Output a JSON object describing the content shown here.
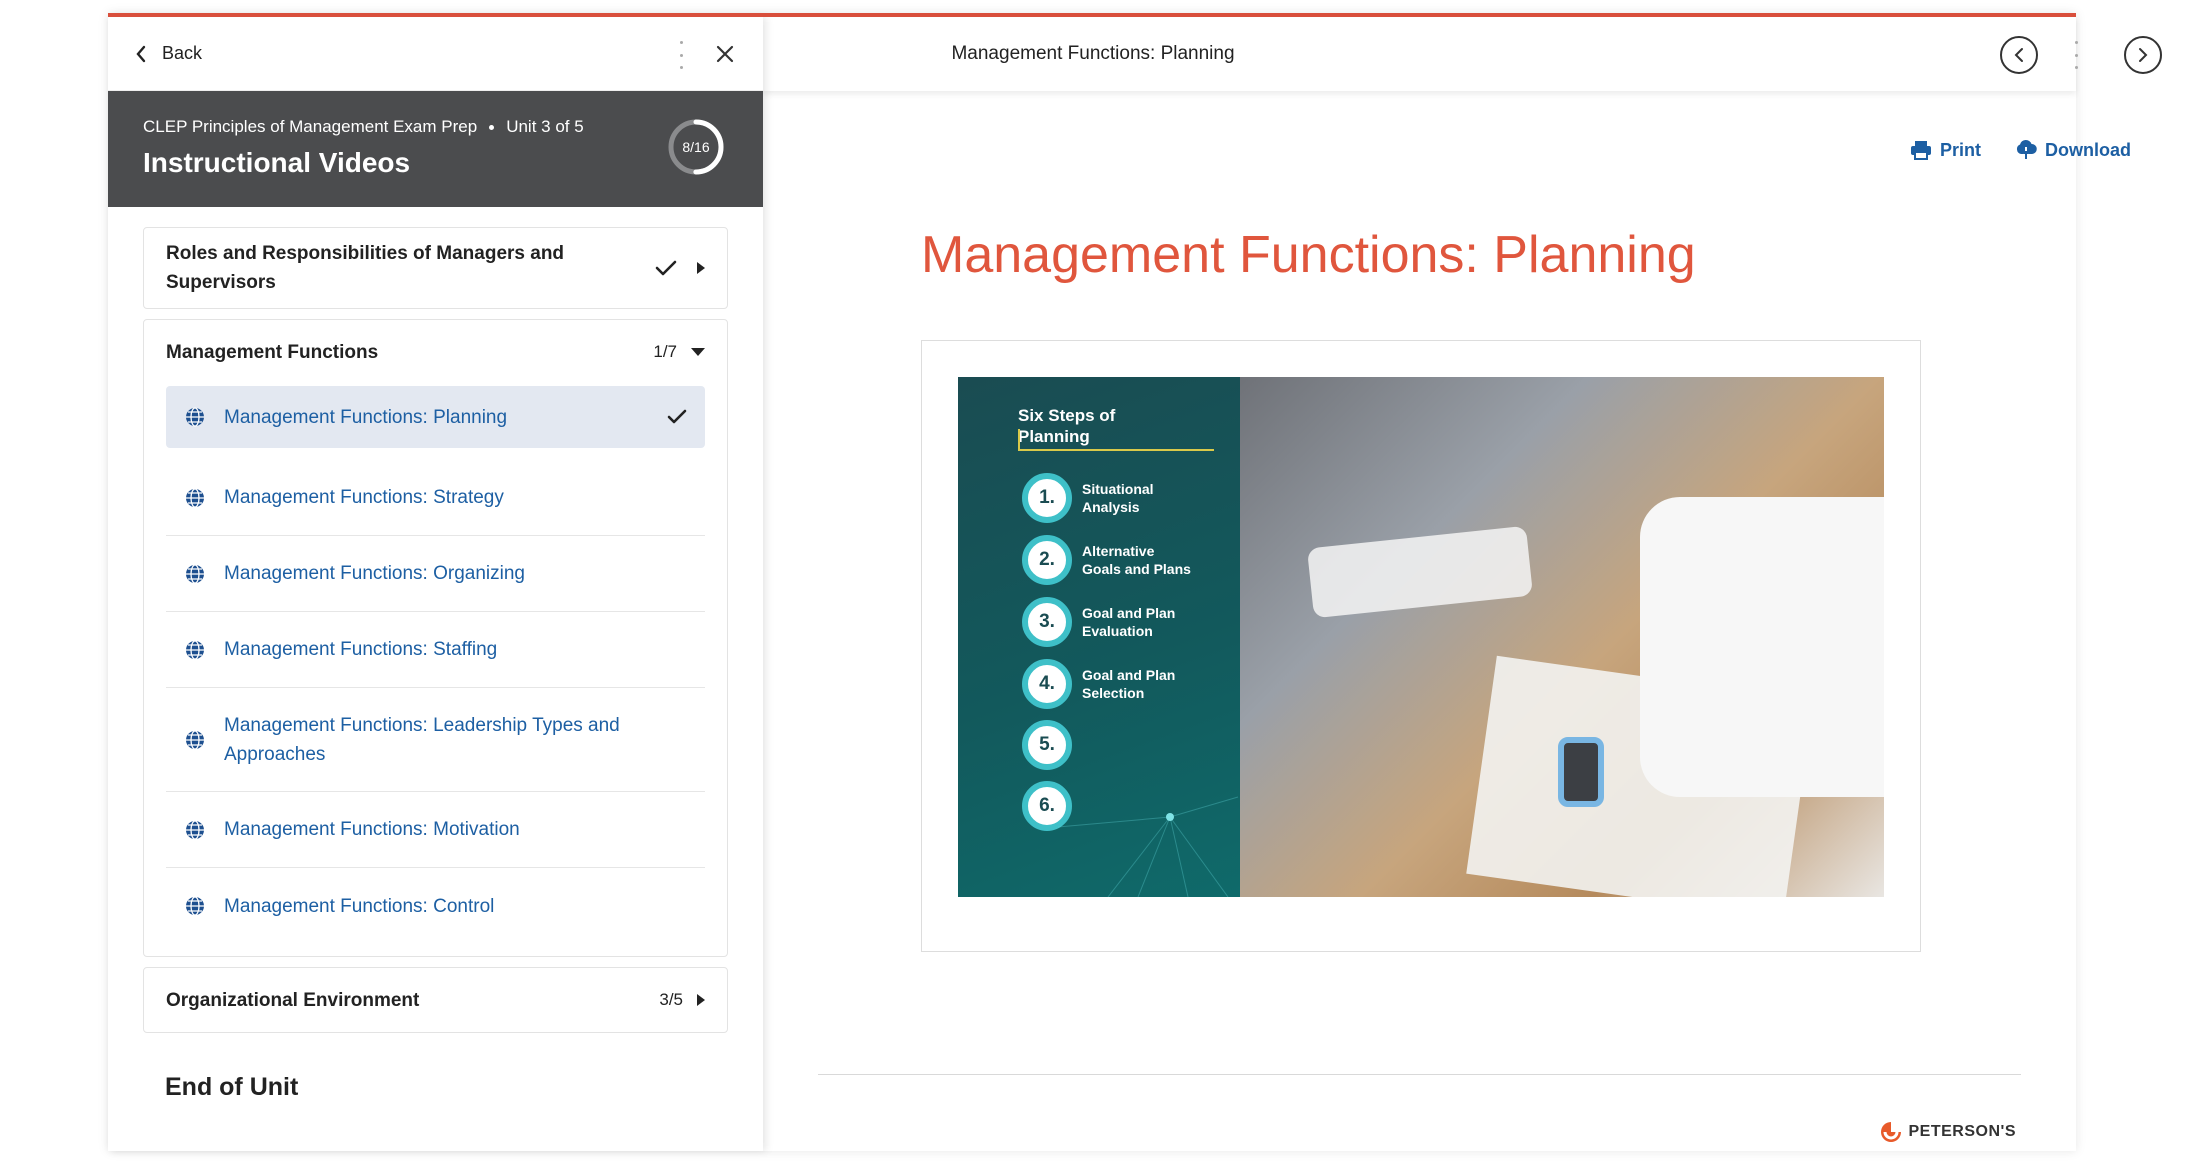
{
  "colors": {
    "accent": "#d94f3c",
    "link": "#1d5fa3",
    "heading": "#e0563d",
    "header_bg": "#4b4c4e",
    "active_bg": "#e3e8f1"
  },
  "sidebar": {
    "back_label": "Back",
    "course_name": "CLEP Principles of Management Exam Prep",
    "unit_label": "Unit 3 of 5",
    "section_title": "Instructional Videos",
    "progress_label": "8/16",
    "progress_fraction": 0.5,
    "sections": [
      {
        "title": "Roles and Responsibilities of Managers and Supervisors",
        "completed": true,
        "expanded": false
      },
      {
        "title": "Management Functions",
        "count": "1/7",
        "expanded": true,
        "lessons": [
          {
            "title": "Management Functions: Planning",
            "active": true,
            "completed": true,
            "icon": "globe-icon"
          },
          {
            "title": "Management Functions: Strategy",
            "icon": "globe-icon"
          },
          {
            "title": "Management Functions: Organizing",
            "icon": "globe-icon"
          },
          {
            "title": "Management Functions: Staffing",
            "icon": "globe-icon"
          },
          {
            "title": "Management Functions: Leadership Types and Approaches",
            "icon": "globe-icon"
          },
          {
            "title": "Management Functions: Motivation",
            "icon": "globe-icon"
          },
          {
            "title": "Management Functions: Control",
            "icon": "globe-icon"
          }
        ]
      },
      {
        "title": "Organizational Environment",
        "count": "3/5",
        "expanded": false
      }
    ],
    "end_of_unit": "End of Unit"
  },
  "content": {
    "header_title": "Management Functions: Planning",
    "print_label": "Print",
    "download_label": "Download",
    "lesson_title": "Management Functions: Planning",
    "slide": {
      "title_line1": "Six Steps of",
      "title_line2": "Planning",
      "steps": [
        {
          "num": "1.",
          "label_line1": "Situational",
          "label_line2": "Analysis"
        },
        {
          "num": "2.",
          "label_line1": "Alternative",
          "label_line2": "Goals and Plans"
        },
        {
          "num": "3.",
          "label_line1": "Goal and Plan",
          "label_line2": "Evaluation"
        },
        {
          "num": "4.",
          "label_line1": "Goal and Plan",
          "label_line2": "Selection"
        },
        {
          "num": "5.",
          "label_line1": "",
          "label_line2": ""
        },
        {
          "num": "6.",
          "label_line1": "",
          "label_line2": ""
        }
      ]
    },
    "brand": "PETERSON'S"
  }
}
